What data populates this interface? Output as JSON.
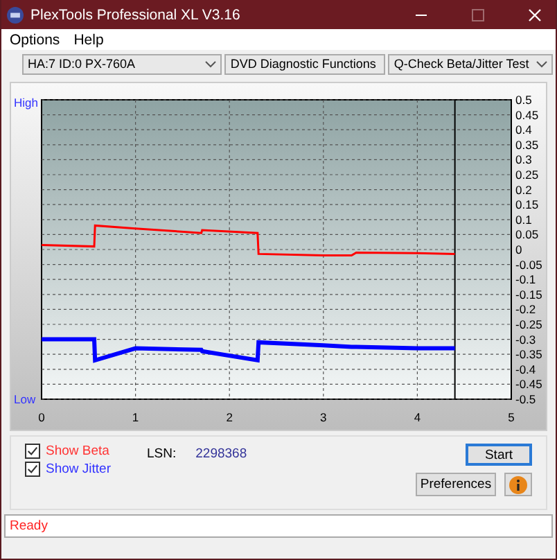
{
  "window": {
    "title": "PlexTools Professional XL V3.16"
  },
  "menu": [
    {
      "label": "Options"
    },
    {
      "label": "Help"
    }
  ],
  "toolbar": {
    "combos": [
      {
        "value": "HA:7 ID:0  PX-760A"
      },
      {
        "value": "DVD Diagnostic Functions"
      },
      {
        "value": "Q-Check Beta/Jitter Test"
      }
    ]
  },
  "chart": {
    "high_label": "High",
    "low_label": "Low",
    "chart_data": {
      "type": "line",
      "grid": true,
      "ref_lines": [
        {
          "axis": "x",
          "value": 4.4,
          "color": "#000000"
        }
      ],
      "xlim": [
        0,
        5
      ],
      "ylim": [
        -0.5,
        0.5
      ],
      "xticks": [
        0,
        1,
        2,
        3,
        4,
        5
      ],
      "yticks": [
        0.5,
        0.45,
        0.4,
        0.35,
        0.3,
        0.25,
        0.2,
        0.15,
        0.1,
        0.05,
        0,
        -0.05,
        -0.1,
        -0.15,
        -0.2,
        -0.25,
        -0.3,
        -0.35,
        -0.4,
        -0.45,
        -0.5
      ],
      "x": [
        0,
        0.56,
        0.57,
        1.0,
        1.7,
        1.71,
        2.3,
        2.31,
        3.0,
        3.3,
        3.35,
        4.0,
        4.4
      ],
      "series": [
        {
          "color": "#ff0000",
          "values": [
            0.015,
            0.01,
            0.08,
            0.07,
            0.055,
            0.065,
            0.055,
            -0.015,
            -0.02,
            -0.02,
            -0.01,
            -0.012,
            -0.015
          ]
        },
        {
          "color": "#0000ff",
          "values": [
            -0.3,
            -0.3,
            -0.37,
            -0.33,
            -0.335,
            -0.34,
            -0.37,
            -0.31,
            -0.32,
            -0.325,
            -0.325,
            -0.33,
            -0.33
          ]
        }
      ]
    }
  },
  "options": [
    {
      "label": "Show Beta",
      "checked": true,
      "color": "#ff3333"
    },
    {
      "label": "Show Jitter",
      "checked": true,
      "color": "#3333ff"
    }
  ],
  "lsn": {
    "label": "LSN:",
    "value": "2298368"
  },
  "buttons": {
    "start": "Start",
    "preferences": "Preferences"
  },
  "status": "Ready"
}
